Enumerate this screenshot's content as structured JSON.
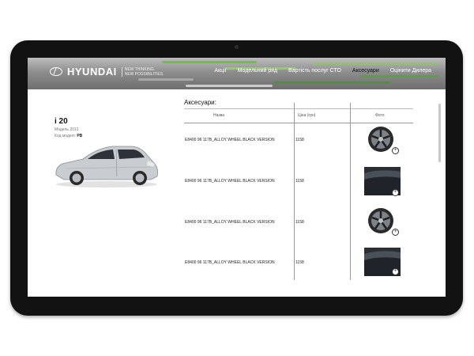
{
  "brand": {
    "logo_text": "HYUNDAI",
    "tagline_line1": "NEW THINKING.",
    "tagline_line2": "NEW POSSIBILITIES."
  },
  "nav": {
    "items": [
      {
        "label": "Акції"
      },
      {
        "label": "Модельний ряд"
      },
      {
        "label": "Вартість послуг СТО"
      },
      {
        "label": "Аксесуари"
      },
      {
        "label": "Оцінити Дилера"
      }
    ],
    "active": "Аксесуари"
  },
  "model": {
    "name": "i 20",
    "year": "Модель 2013",
    "code_label": "Код моделі:",
    "code_value": "PB"
  },
  "accessories": {
    "title": "Аксесуари:",
    "columns": [
      "Назва",
      "Ціна (грн)",
      "Фото"
    ],
    "rows": [
      {
        "name": "E8400 96 117B_ALLOY WHEEL BLACK VERSION",
        "price": "1158",
        "photo": "alloy-wheel"
      },
      {
        "name": "E8400 96 117B_ALLOY WHEEL BLACK VERSION",
        "price": "1158",
        "photo": "roof-spoiler"
      },
      {
        "name": "E8400 96 117B_ALLOY WHEEL BLACK VERSION",
        "price": "1158",
        "photo": "alloy-wheel"
      },
      {
        "name": "E8400 96 117B_ALLOY WHEEL BLACK VERSION",
        "price": "1158",
        "photo": "roof-spoiler"
      }
    ]
  },
  "colors": {
    "device_bezel": "#121212",
    "header_gray": "#8d8d8d",
    "car_silver": "#c9ccd0"
  },
  "icons": {
    "zoom": "zoom-icon",
    "logo": "hyundai-logo-icon"
  }
}
